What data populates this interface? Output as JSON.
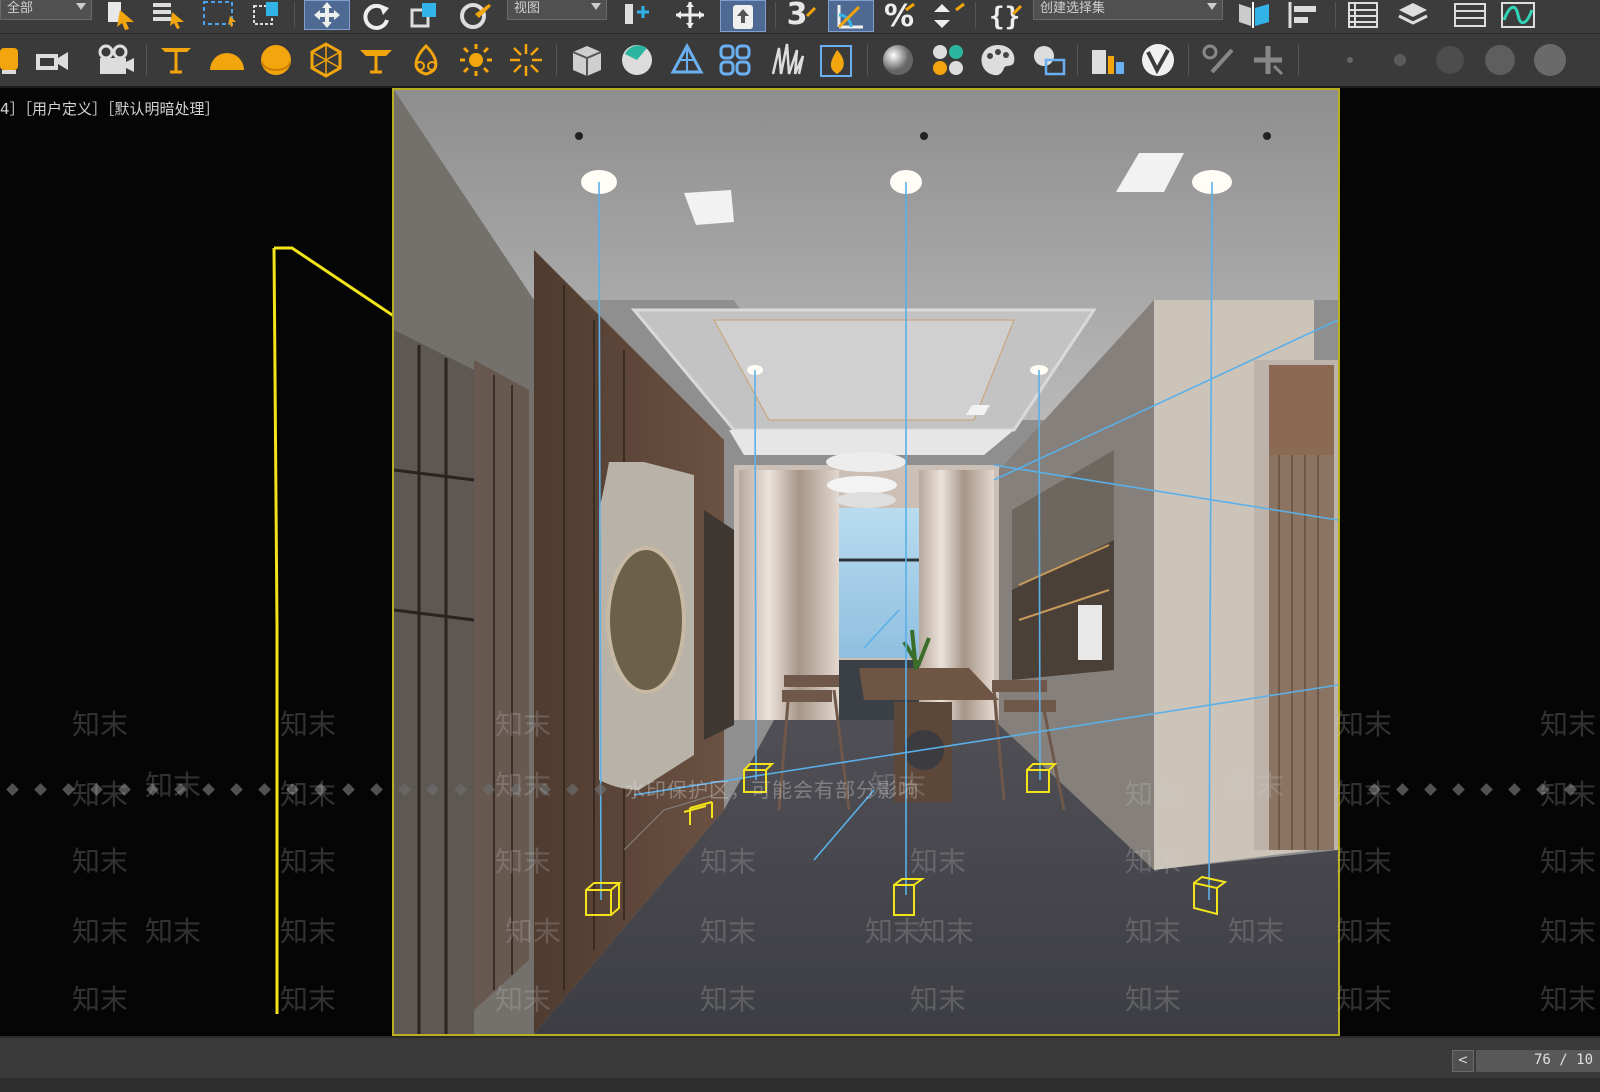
{
  "toolbar_top": {
    "selection_filter": "全部",
    "reference_coord": "视图",
    "snap_number": "3",
    "named_selection": "创建选择集",
    "icons": [
      "select-object-icon",
      "select-by-name-icon",
      "rect-selection-region-icon",
      "window-crossing-icon",
      "select-and-move-icon",
      "select-and-rotate-icon",
      "select-and-scale-icon",
      "select-and-place-icon",
      "use-pivot-center-icon",
      "select-and-manipulate-icon",
      "keyboard-shortcut-override-icon",
      "snaps-toggle-icon",
      "angle-snap-icon",
      "percent-snap-icon",
      "spinner-snap-icon",
      "edit-named-selection-icon",
      "mirror-icon",
      "align-icon",
      "scene-explorer-icon",
      "layer-explorer-icon",
      "ribbon-icon",
      "curve-editor-icon"
    ]
  },
  "toolbar_second": {
    "icons": [
      "render-setup-icon",
      "rendered-frame-window-icon",
      "render-production-icon",
      "free-spot-light-icon",
      "omni-light-icon",
      "sky-dome-icon",
      "vray-sphere-light-icon",
      "mesh-light-icon",
      "ies-light-icon",
      "sun-icon",
      "ambient-light-icon",
      "vray-proxy-icon",
      "vray-fur-icon",
      "clipper-icon",
      "grass-icon",
      "fire-icon",
      "material-sphere-icon",
      "material-editor-icon",
      "color-palette-icon",
      "material-multi-icon",
      "vray-frame-buffer-icon",
      "vray-logo-icon",
      "brush-icon",
      "toolbox-icon",
      "dot-tiny-icon",
      "dot-small-icon",
      "sphere-dim-icon",
      "sphere-mid-icon",
      "sphere-light-icon"
    ]
  },
  "viewport": {
    "label": "4］［用户定义］［默认明暗处理］"
  },
  "watermark": {
    "note": "水印保护区，可能会有部分影响",
    "text": "知末"
  },
  "timeline": {
    "prev_label": "<",
    "frame_counter": "76 / 10"
  },
  "colors": {
    "toolbar_bg": "#3c3c3c",
    "selection_yellow": "#f2e31a",
    "light_blue": "#5ab0e8",
    "safe_frame": "#b8b020",
    "orange_icon": "#f2a50c"
  }
}
